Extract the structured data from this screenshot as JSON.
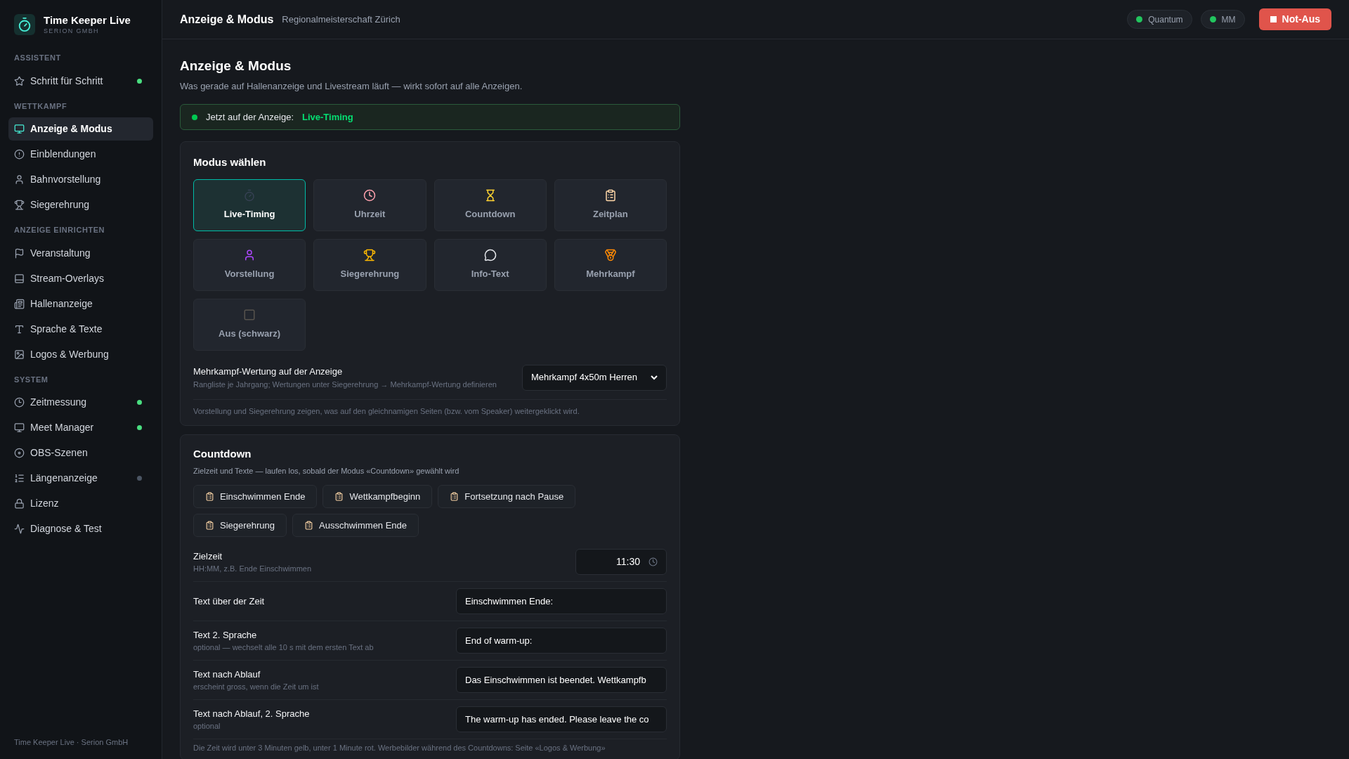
{
  "app": {
    "name": "Time Keeper Live",
    "company": "SERION GMBH"
  },
  "sidebar": {
    "sections": [
      {
        "title": "ASSISTENT",
        "items": [
          {
            "label": "Schritt für Schritt",
            "selected": false,
            "color": "#4ade80"
          }
        ]
      },
      {
        "title": "WETTKAMPF",
        "items": [
          {
            "label": "Anzeige & Modus",
            "selected": true
          },
          {
            "label": "Einblendungen",
            "selected": false
          },
          {
            "label": "Bahnvorstellung",
            "selected": false
          },
          {
            "label": "Siegerehrung",
            "selected": false
          }
        ]
      },
      {
        "title": "ANZEIGE EINRICHTEN",
        "items": [
          {
            "label": "Veranstaltung",
            "selected": false
          },
          {
            "label": "Stream-Overlays",
            "selected": false
          },
          {
            "label": "Hallenanzeige",
            "selected": false
          },
          {
            "label": "Sprache & Texte",
            "selected": false
          },
          {
            "label": "Logos & Werbung",
            "selected": false
          }
        ]
      },
      {
        "title": "SYSTEM",
        "items": [
          {
            "label": "Zeitmessung",
            "selected": false,
            "color": "#4ade80"
          },
          {
            "label": "Meet Manager",
            "selected": false,
            "color": "#4ade80"
          },
          {
            "label": "OBS-Szenen",
            "selected": false
          },
          {
            "label": "Längenanzeige",
            "selected": false,
            "color": "#4b5563"
          },
          {
            "label": "Lizenz",
            "selected": false
          },
          {
            "label": "Diagnose & Test",
            "selected": false
          }
        ]
      }
    ],
    "footer": "Time Keeper Live · Serion GmbH"
  },
  "header": {
    "title": "Anzeige & Modus",
    "subtitle": "Regionalmeisterschaft Zürich",
    "status": [
      {
        "label": "Quantum",
        "color": "#22c55e"
      },
      {
        "label": "MM",
        "color": "#22c55e"
      }
    ],
    "stop_button": "Not-Aus"
  },
  "page": {
    "title": "Anzeige & Modus",
    "description": "Was gerade auf Hallenanzeige und Livestream läuft — wirkt sofort auf alle Anzeigen.",
    "banner": {
      "label": "Jetzt auf der Anzeige:",
      "value": "Live-Timing"
    }
  },
  "mode_card": {
    "title": "Modus wählen",
    "modes": [
      {
        "label": "Live-Timing",
        "selected": true
      },
      {
        "label": "Uhrzeit",
        "selected": false
      },
      {
        "label": "Countdown",
        "selected": false
      },
      {
        "label": "Zeitplan",
        "selected": false
      },
      {
        "label": "Vorstellung",
        "selected": false
      },
      {
        "label": "Siegerehrung",
        "selected": false
      },
      {
        "label": "Info-Text",
        "selected": false
      },
      {
        "label": "Mehrkampf",
        "selected": false
      },
      {
        "label": "Aus (schwarz)",
        "selected": false
      }
    ],
    "setting": {
      "label": "Mehrkampf-Wertung auf der Anzeige",
      "hint": "Rangliste je Jahrgang; Wertungen unter Siegerehrung → Mehrkampf-Wertung definieren",
      "value": "Mehrkampf 4x50m Herren"
    },
    "note": "Vorstellung und Siegerehrung zeigen, was auf den gleichnamigen Seiten (bzw. vom Speaker) weitergeklickt wird."
  },
  "countdown_card": {
    "title": "Countdown",
    "description": "Zielzeit und Texte — laufen los, sobald der Modus «Countdown» gewählt wird",
    "presets": [
      "Einschwimmen Ende",
      "Wettkampfbeginn",
      "Fortsetzung nach Pause",
      "Siegerehrung",
      "Ausschwimmen Ende"
    ],
    "fields": [
      {
        "kind": "time",
        "label": "Zielzeit",
        "hint": "HH:MM, z.B. Ende Einschwimmen",
        "value": "11:30"
      },
      {
        "kind": "text",
        "label": "Text über der Zeit",
        "value": "Einschwimmen Ende:"
      },
      {
        "kind": "text",
        "label": "Text 2. Sprache",
        "hint": "optional — wechselt alle 10 s mit dem ersten Text ab",
        "value": "End of warm-up:"
      },
      {
        "kind": "text",
        "label": "Text nach Ablauf",
        "hint": "erscheint gross, wenn die Zeit um ist",
        "value": "Das Einschwimmen ist beendet. Wettkampfb"
      },
      {
        "kind": "text",
        "label": "Text nach Ablauf, 2. Sprache",
        "hint": "optional",
        "value": "The warm-up has ended. Please leave the co"
      }
    ],
    "note": "Die Zeit wird unter 3 Minuten gelb, unter 1 Minute rot. Werbebilder während des Countdowns: Seite «Logos & Werbung»"
  }
}
